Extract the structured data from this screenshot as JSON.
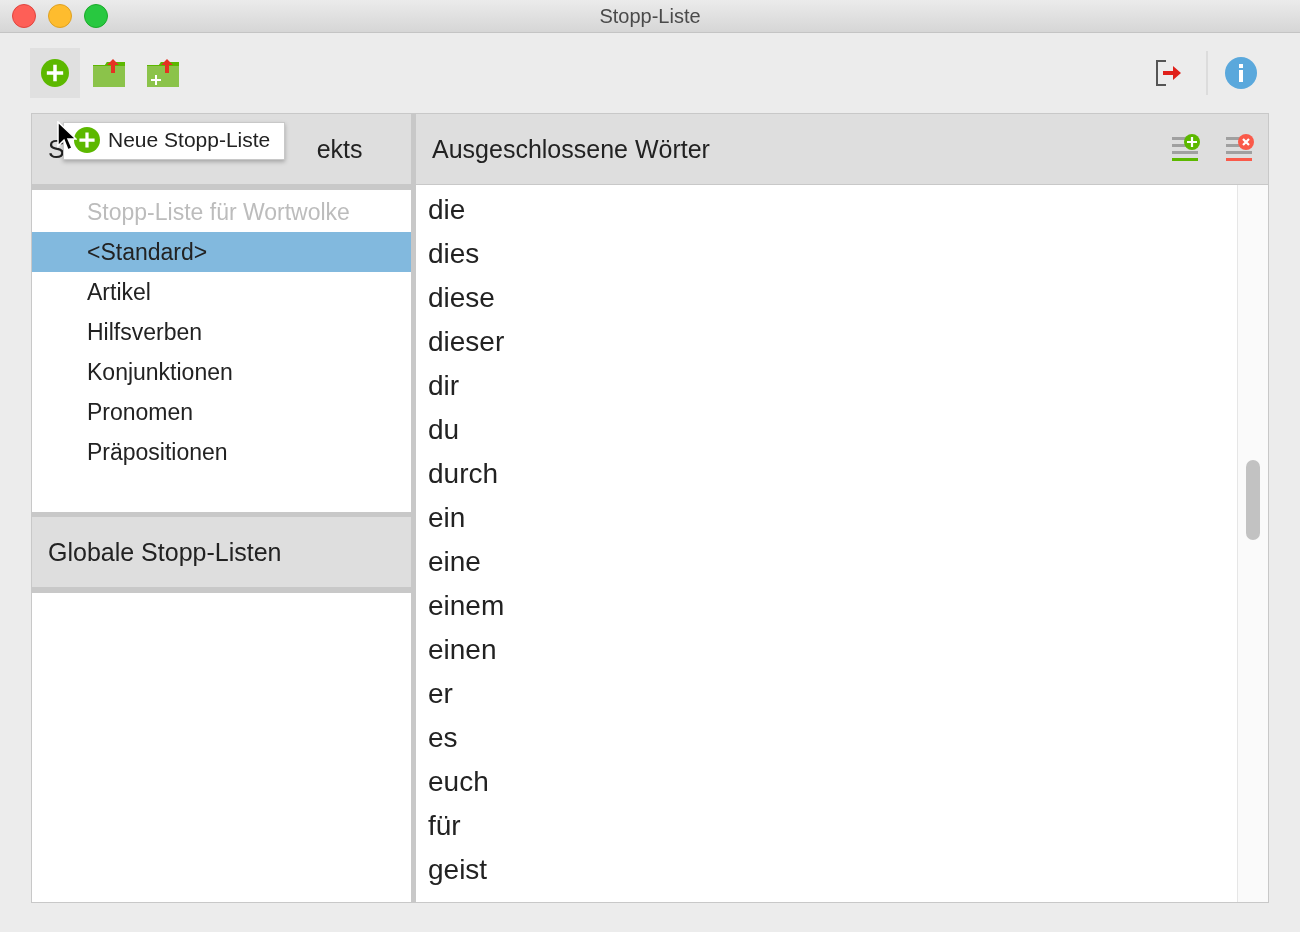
{
  "window": {
    "title": "Stopp-Liste"
  },
  "toolbar": {
    "tooltip": "Neue Stopp-Liste"
  },
  "project_lists": {
    "title_parts": [
      "S",
      "ekts"
    ],
    "items": [
      {
        "label": "Stopp-Liste für Wortwolke",
        "disabled": true,
        "selected": false
      },
      {
        "label": "<Standard>",
        "disabled": false,
        "selected": true
      },
      {
        "label": "Artikel",
        "disabled": false,
        "selected": false
      },
      {
        "label": "Hilfsverben",
        "disabled": false,
        "selected": false
      },
      {
        "label": "Konjunktionen",
        "disabled": false,
        "selected": false
      },
      {
        "label": "Pronomen",
        "disabled": false,
        "selected": false
      },
      {
        "label": "Präpositionen",
        "disabled": false,
        "selected": false
      }
    ]
  },
  "global_lists": {
    "title": "Globale Stopp-Listen"
  },
  "excluded_words": {
    "title": "Ausgeschlossene Wörter",
    "words": [
      "die",
      "dies",
      "diese",
      "dieser",
      "dir",
      "du",
      "durch",
      "ein",
      "eine",
      "einem",
      "einen",
      "er",
      "es",
      "euch",
      "für",
      "geist"
    ]
  }
}
